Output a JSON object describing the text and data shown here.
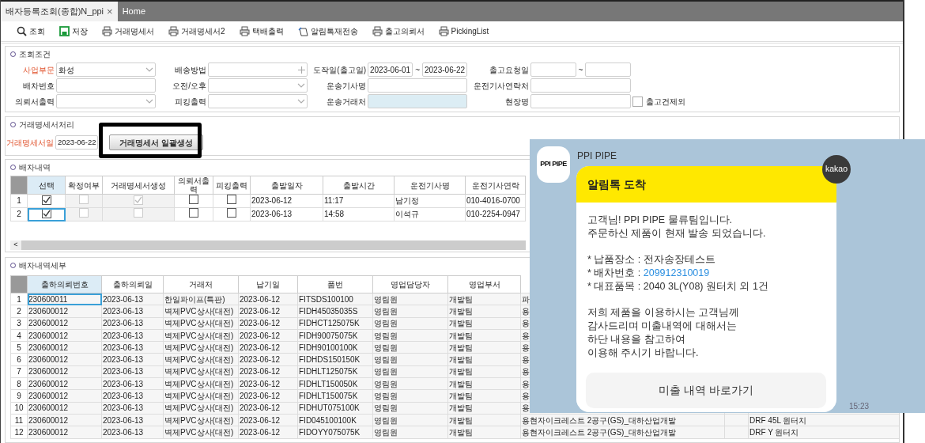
{
  "tabs": [
    {
      "label": "배자등록조회(종합)N_ppi",
      "selected": true,
      "close": "×"
    },
    {
      "label": "Home",
      "selected": false
    }
  ],
  "toolbar": [
    {
      "label": "조회",
      "kind": "search"
    },
    {
      "label": "저장",
      "kind": "save"
    },
    {
      "label": "거래명세서",
      "kind": "print"
    },
    {
      "label": "거래명세서2",
      "kind": "print"
    },
    {
      "label": "택배출력",
      "kind": "print"
    },
    {
      "label": "알림톡재전송",
      "kind": "message"
    },
    {
      "label": "출고의뢰서",
      "kind": "print"
    },
    {
      "label": "PickingList",
      "kind": "print"
    }
  ],
  "search_panel": {
    "title": "조회조건",
    "rows": [
      [
        {
          "label": "사업부문",
          "required": true,
          "kind": "select",
          "value": "화성"
        },
        {
          "label": "배송방법",
          "required": false,
          "kind": "lookup"
        },
        {
          "label": "도작일(출고일)",
          "required": false,
          "kind": "range",
          "from": "2023-06-01",
          "sep": "~",
          "to": "2023-06-22"
        },
        {
          "label": "출고요청일",
          "required": false,
          "kind": "range",
          "sep": "~"
        }
      ],
      [
        {
          "label": "배차번호",
          "required": false,
          "kind": "text"
        },
        {
          "label": "오전/오후",
          "required": false,
          "kind": "select"
        },
        {
          "label": "운송기사명",
          "required": false,
          "kind": "text"
        },
        {
          "label": "운전기사연락처",
          "required": false,
          "kind": "text"
        }
      ],
      [
        {
          "label": "의뢰서출력",
          "required": false,
          "kind": "select"
        },
        {
          "label": "피킹출력",
          "required": false,
          "kind": "select"
        },
        {
          "label": "운송거래처",
          "required": false,
          "kind": "tinted"
        },
        {
          "label": "현장명",
          "required": false,
          "kind": "text",
          "checkbox": {
            "label": "출고건제외",
            "checked": false
          }
        }
      ]
    ]
  },
  "invoice_panel": {
    "title": "거래명세서처리",
    "label": "거래명세서일",
    "date": "2023-06-22",
    "button": "거래명세서 일괄생성",
    "highlighted": true
  },
  "dispatch_panel": {
    "title": "배차내역",
    "columns": [
      {
        "label": "선택",
        "active": true
      },
      {
        "label": "확정여부",
        "active": false
      },
      {
        "label": "거래명세서생성",
        "active": false
      },
      {
        "label": "의뢰서출력",
        "active": false
      },
      {
        "label": "피킹출력",
        "active": false
      },
      {
        "label": "출발일자",
        "active": false
      },
      {
        "label": "출발시간",
        "active": false
      },
      {
        "label": "운전기사명",
        "active": false
      },
      {
        "label": "운전기사연락",
        "active": false
      }
    ],
    "rows": [
      {
        "number": "1",
        "focused": false,
        "checks": [
          {
            "checked": true,
            "disabled": false
          },
          {
            "checked": false,
            "disabled": true
          },
          {
            "checked": true,
            "disabled": true
          },
          {
            "checked": false,
            "disabled": false
          },
          {
            "checked": false,
            "disabled": false
          }
        ],
        "cells": [
          "2023-06-12",
          "11:17",
          "남기정",
          "010-4016-0700"
        ]
      },
      {
        "number": "2",
        "focused": true,
        "checks": [
          {
            "checked": true,
            "disabled": false
          },
          {
            "checked": false,
            "disabled": true
          },
          {
            "checked": false,
            "disabled": true
          },
          {
            "checked": false,
            "disabled": false
          },
          {
            "checked": false,
            "disabled": false
          }
        ],
        "cells": [
          "2023-06-13",
          "14:58",
          "이석규",
          "010-2254-0947"
        ]
      }
    ],
    "scroll_left": "<"
  },
  "detail_panel": {
    "title": "배차내역세부",
    "columns": [
      {
        "label": "출하의뢰번호",
        "active": true
      },
      {
        "label": "출하의뢰일",
        "active": false
      },
      {
        "label": "거래처",
        "active": false
      },
      {
        "label": "납기일",
        "active": false
      },
      {
        "label": "품번",
        "active": false
      },
      {
        "label": "영업담당자",
        "active": false
      },
      {
        "label": "영업부서",
        "active": false
      }
    ],
    "rows": [
      {
        "number": "1",
        "focused": true,
        "cells": [
          "230600011",
          "2023-06-13",
          "한일파이프(특판)",
          "2023-06-12",
          "FITSDS100100",
          "영림원",
          "개발팀",
          "파"
        ]
      },
      {
        "number": "2",
        "focused": false,
        "cells": [
          "230600012",
          "2023-06-13",
          "벽제PVC상사(대전)",
          "2023-06-12",
          "FIDH45035035S",
          "영림원",
          "개발팀",
          "용"
        ]
      },
      {
        "number": "3",
        "focused": false,
        "cells": [
          "230600012",
          "2023-06-13",
          "벽제PVC상사(대전)",
          "2023-06-12",
          "FIDHCT125075K",
          "영림원",
          "개발팀",
          "용"
        ]
      },
      {
        "number": "4",
        "focused": false,
        "cells": [
          "230600012",
          "2023-06-13",
          "벽제PVC상사(대전)",
          "2023-06-12",
          "FIDH90075075K",
          "영림원",
          "개발팀",
          "용"
        ]
      },
      {
        "number": "5",
        "focused": false,
        "cells": [
          "230600012",
          "2023-06-13",
          "벽제PVC상사(대전)",
          "2023-06-12",
          "FIDH90100100K",
          "영림원",
          "개발팀",
          "용"
        ]
      },
      {
        "number": "6",
        "focused": false,
        "cells": [
          "230600012",
          "2023-06-13",
          "벽제PVC상사(대전)",
          "2023-06-12",
          "FIDHDS150150K",
          "영림원",
          "개발팀",
          "용"
        ]
      },
      {
        "number": "7",
        "focused": false,
        "cells": [
          "230600012",
          "2023-06-13",
          "벽제PVC상사(대전)",
          "2023-06-12",
          "FIDHLT125075K",
          "영림원",
          "개발팀",
          "용"
        ]
      },
      {
        "number": "8",
        "focused": false,
        "cells": [
          "230600012",
          "2023-06-13",
          "벽제PVC상사(대전)",
          "2023-06-12",
          "FIDHLT150050K",
          "영림원",
          "개발팀",
          "용"
        ]
      },
      {
        "number": "9",
        "focused": false,
        "cells": [
          "230600012",
          "2023-06-13",
          "벽제PVC상사(대전)",
          "2023-06-12",
          "FIDHLT150075K",
          "영림원",
          "개발팀",
          "용"
        ]
      },
      {
        "number": "10",
        "focused": false,
        "cells": [
          "230600012",
          "2023-06-13",
          "벽제PVC상사(대전)",
          "2023-06-12",
          "FIDHUT075100K",
          "영림원",
          "개발팀",
          "용"
        ]
      },
      {
        "number": "11",
        "focused": false,
        "cells": [
          "230600012",
          "2023-06-13",
          "벽제PVC상사(대전)",
          "2023-06-12",
          "FID045100100K",
          "영림원",
          "개발팀",
          "용현자이크레스트 2공구(GS)_대하산업개발"
        ],
        "column_10": "DRF 45L 원터치"
      },
      {
        "number": "12",
        "focused": false,
        "cells": [
          "230600012",
          "2023-06-13",
          "벽제PVC상사(대전)",
          "2023-06-12",
          "FIDOYY075075K",
          "영림원",
          "개발팀",
          "용현자이크레스트 2공구(GS)_대하산업개발"
        ],
        "column_10": "DRF Y 원터치"
      }
    ]
  },
  "message": {
    "logo": "PPI PIPE",
    "sender": "PPI PIPE",
    "badge": "kakao",
    "header": "알림톡 도착",
    "blocks": [
      {
        "kind": "lines",
        "lines": [
          "고객님! PPI PIPE 물류팀입니다.",
          "주문하신 제품이 현재 발송 되었습니다."
        ]
      },
      {
        "kind": "details",
        "items": [
          {
            "label": "* 납품장소 : ",
            "value": "전자송장테스트",
            "link": false
          },
          {
            "label": "* 배차번호 : ",
            "value": "209912310019",
            "link": true
          },
          {
            "label": "* 대표품목 : ",
            "value": "2040 3L(Y08) 원터치 외 1건",
            "link": false
          }
        ]
      },
      {
        "kind": "lines",
        "lines": [
          "저희 제품을 이용하시는 고객님께",
          "감사드리며 미출내역에 대해서는",
          "하단 내용을 참고하여",
          "이용해 주시기 바랍니다."
        ]
      }
    ],
    "button": "미출 내역 바로가기",
    "time": "15:23"
  }
}
